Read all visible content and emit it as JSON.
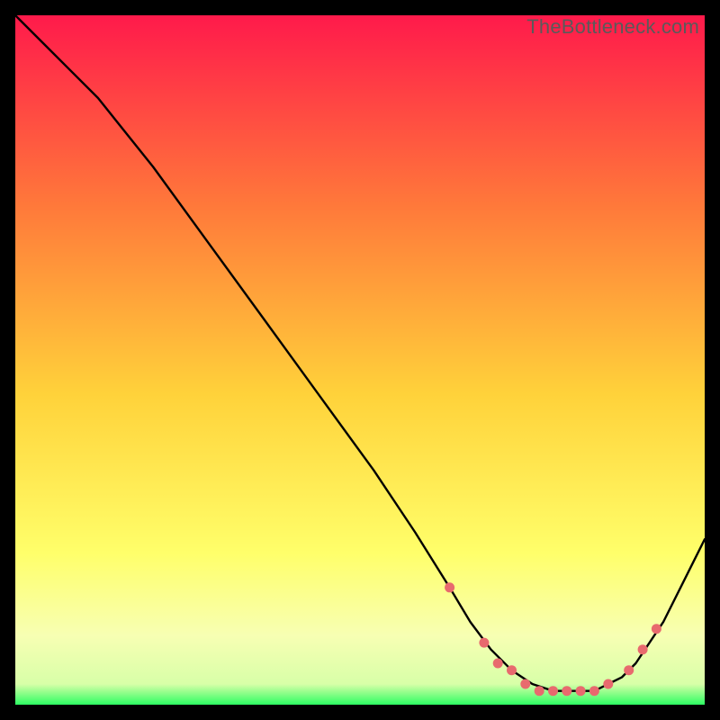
{
  "watermark": "TheBottleneck.com",
  "colors": {
    "bg_black": "#000000",
    "grad_top": "#ff1a4b",
    "grad_mid1": "#ff7a3a",
    "grad_mid2": "#ffd23a",
    "grad_mid3": "#ffff6a",
    "grad_pale": "#f7ffb3",
    "grad_green": "#2dfd62",
    "line": "#000000",
    "marker": "#e86a6e"
  },
  "chart_data": {
    "type": "line",
    "title": "",
    "xlabel": "",
    "ylabel": "",
    "xlim": [
      0,
      100
    ],
    "ylim": [
      0,
      100
    ],
    "series": [
      {
        "name": "curve",
        "x": [
          0,
          4,
          8,
          12,
          20,
          28,
          36,
          44,
          52,
          58,
          63,
          66,
          69,
          72,
          75,
          78,
          81,
          84,
          86,
          88,
          90,
          94,
          100
        ],
        "y": [
          100,
          96,
          92,
          88,
          78,
          67,
          56,
          45,
          34,
          25,
          17,
          12,
          8,
          5,
          3,
          2,
          2,
          2,
          3,
          4,
          6,
          12,
          24
        ]
      }
    ],
    "markers": {
      "name": "highlight-points",
      "x": [
        63,
        68,
        70,
        72,
        74,
        76,
        78,
        80,
        82,
        84,
        86,
        89,
        91,
        93
      ],
      "y": [
        17,
        9,
        6,
        5,
        3,
        2,
        2,
        2,
        2,
        2,
        3,
        5,
        8,
        11
      ]
    }
  }
}
